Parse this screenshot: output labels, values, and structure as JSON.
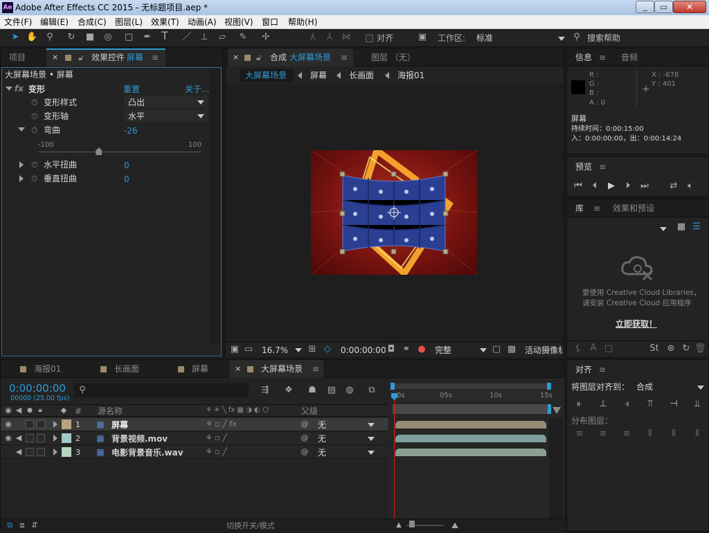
{
  "window": {
    "title": "Adobe After Effects CC 2015 - 无标题项目.aep *",
    "app_icon": "Ae"
  },
  "menu": [
    "文件(F)",
    "编辑(E)",
    "合成(C)",
    "图层(L)",
    "效果(T)",
    "动画(A)",
    "视图(V)",
    "窗口",
    "帮助(H)"
  ],
  "toolbar": {
    "align_label": "对齐",
    "workspace_label": "工作区:",
    "workspace_value": "标准",
    "search_label": "搜索帮助"
  },
  "left_panel": {
    "tab_project": "项目",
    "tab_effects": "效果控件",
    "tab_effects_target": "屏幕",
    "breadcrumb": "大屏幕场景 • 屏幕",
    "effect_name": "变形",
    "reset": "重置",
    "about": "关于...",
    "rows": {
      "style_label": "变形样式",
      "style_value": "凸出",
      "axis_label": "变形轴",
      "axis_value": "水平",
      "bend_label": "弯曲",
      "bend_value": "-26",
      "bend_min": "-100",
      "bend_max": "100",
      "bend_level": 0.37,
      "h_label": "水平扭曲",
      "h_value": "0",
      "v_label": "垂直扭曲",
      "v_value": "0"
    }
  },
  "comp_panel": {
    "tab_label": "合成",
    "tab_comp": "大屏幕场景",
    "layer_tab": "图层 （无）",
    "nav": [
      "大屏幕场景",
      "屏幕",
      "长画面",
      "海报01"
    ],
    "zoom": "16.7%",
    "time": "0:00:00:00",
    "quality": "完整",
    "camera": "活动摄像机"
  },
  "info_panel": {
    "tab_info": "信息",
    "tab_audio": "音频",
    "r": "R :",
    "g": "G :",
    "b": "B :",
    "a": "A : 0",
    "x": "X : -678",
    "y": "Y : 401",
    "layer": "屏幕",
    "duration": "持续时间：0:00:15:00",
    "inout": "入：0:00:00:00，出：0:00:14:24"
  },
  "preview_panel": {
    "title": "预览"
  },
  "library_panel": {
    "tab_lib": "库",
    "tab_fx": "效果和预设",
    "msg1": "要使用 Creative Cloud Libraries，",
    "msg2": "请安装 Creative Cloud 应用程序",
    "link": "立即获取！"
  },
  "timeline": {
    "tabs": [
      "海报01",
      "长画面",
      "屏幕",
      "大屏幕场景"
    ],
    "tab_colors": [
      "#9b8a6a",
      "#9b8a6a",
      "#9b8a6a",
      "#9b8a6a"
    ],
    "timecode": "0:00:00:00",
    "frames": "00000 (25.00 fps)",
    "col_num": "#",
    "col_name": "源名称",
    "col_parent": "父级",
    "ruler": [
      "0s",
      "05s",
      "10s",
      "15s"
    ],
    "toggle_label": "切换开关/模式",
    "layers": [
      {
        "num": "1",
        "name": "屏幕",
        "parent": "无",
        "color": "#b9a37f",
        "track": "#9a8a78"
      },
      {
        "num": "2",
        "name": "背景视频.mov",
        "parent": "无",
        "color": "#9fc8c8",
        "track": "#7f9f9c"
      },
      {
        "num": "3",
        "name": "电影背景音乐.wav",
        "parent": "无",
        "color": "#b8d6c0",
        "track": "#8a9e94"
      }
    ]
  },
  "align_panel": {
    "title": "对齐",
    "align_to_label": "将图层对齐到：",
    "align_to_value": "合成",
    "distribute_label": "分布图层："
  }
}
